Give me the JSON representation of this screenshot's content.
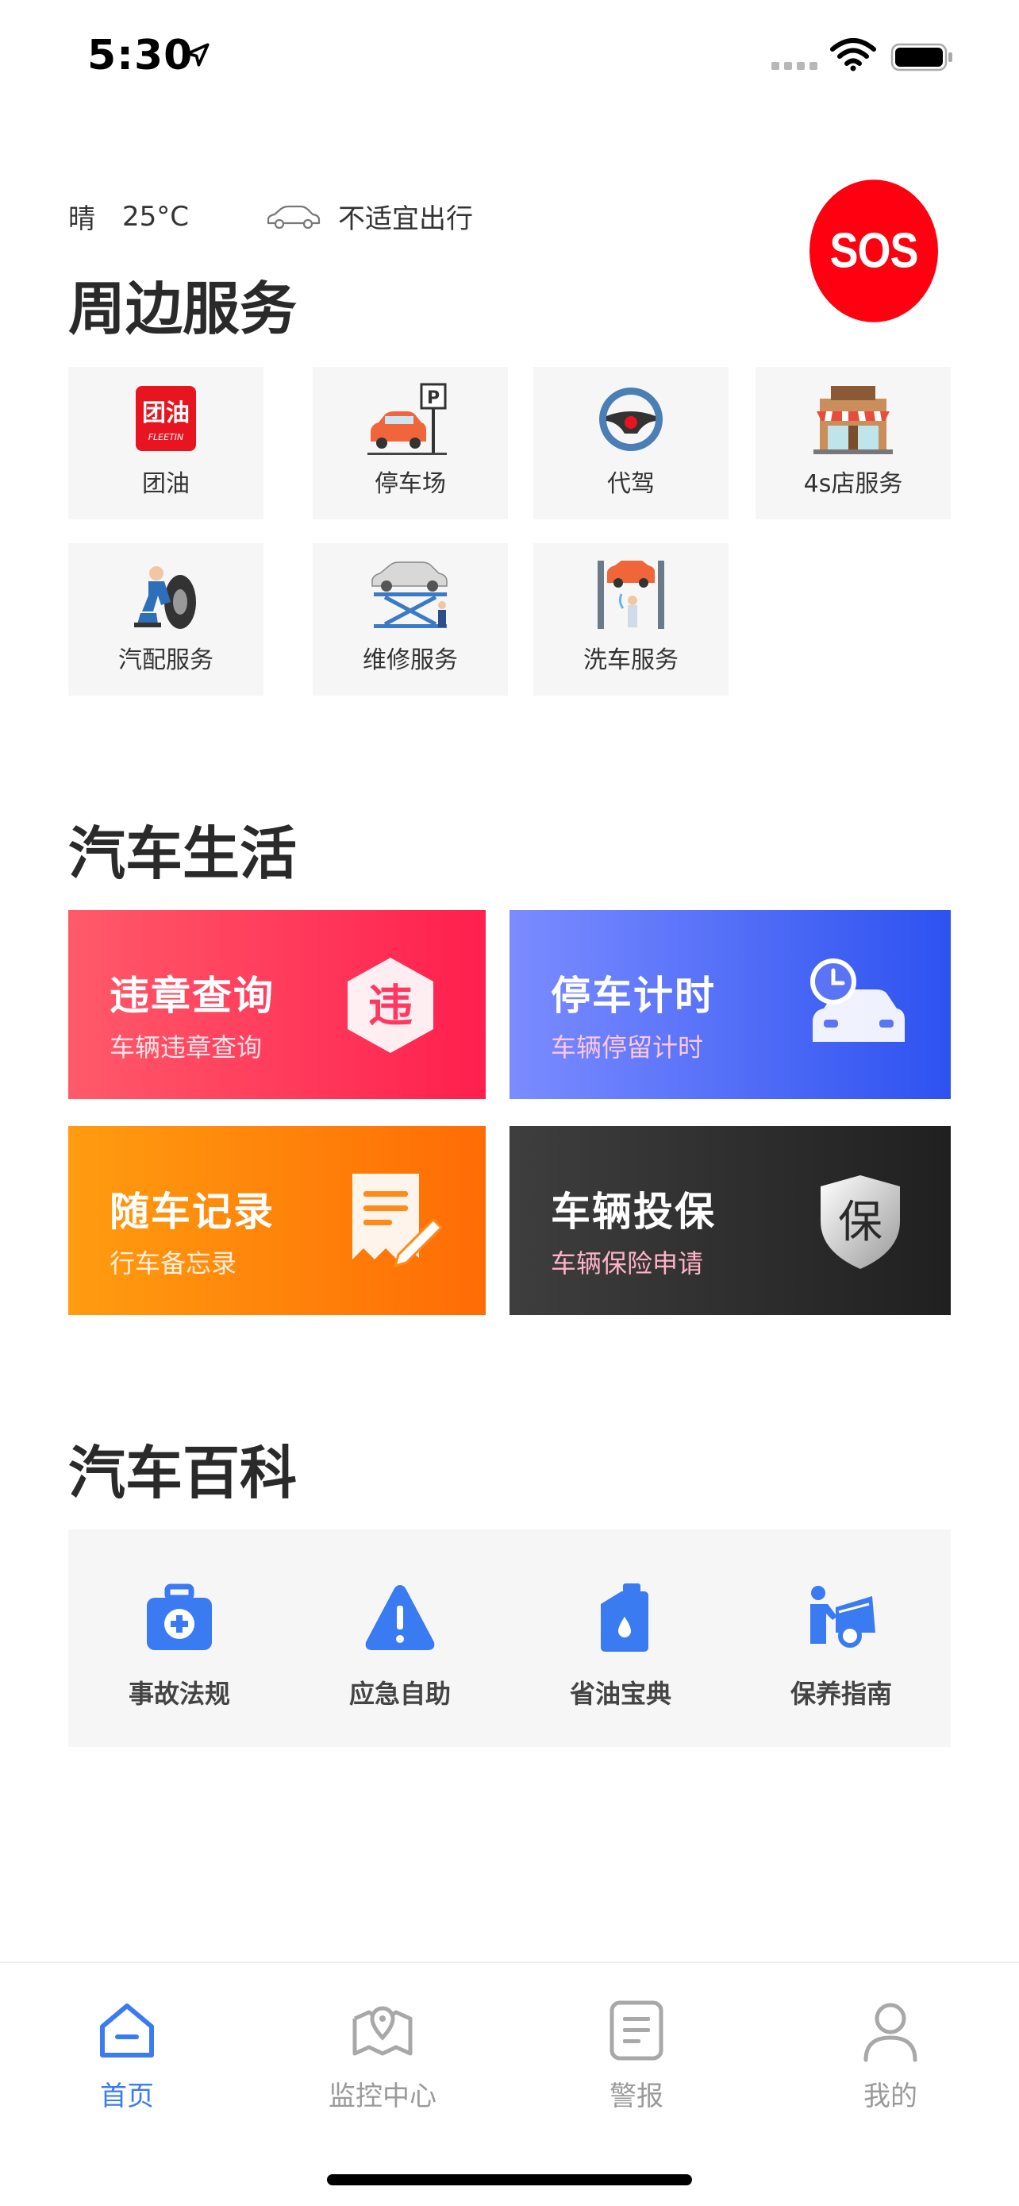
{
  "status_bar": {
    "time": "5:30"
  },
  "weather": {
    "condition": "晴",
    "temperature": "25°C",
    "travel_advice": "不适宜出行"
  },
  "sos": {
    "label": "SOS"
  },
  "sections": {
    "nearby": "周边服务",
    "car_life": "汽车生活",
    "encyclopedia": "汽车百科"
  },
  "services": [
    {
      "label": "团油",
      "icon": "fuel-logo-icon",
      "logo_text": "团油",
      "logo_sub": "FLEETIN"
    },
    {
      "label": "停车场",
      "icon": "parking-icon"
    },
    {
      "label": "代驾",
      "icon": "steering-wheel-icon"
    },
    {
      "label": "4s店服务",
      "icon": "dealership-icon"
    },
    {
      "label": "汽配服务",
      "icon": "tire-mechanic-icon"
    },
    {
      "label": "维修服务",
      "icon": "car-lift-icon"
    },
    {
      "label": "洗车服务",
      "icon": "car-wash-icon"
    }
  ],
  "car_life": [
    {
      "title": "违章查询",
      "subtitle": "车辆违章查询",
      "icon": "violation-icon",
      "glyph": "违"
    },
    {
      "title": "停车计时",
      "subtitle": "车辆停留计时",
      "icon": "parking-timer-icon"
    },
    {
      "title": "随车记录",
      "subtitle": "行车备忘录",
      "icon": "note-icon"
    },
    {
      "title": "车辆投保",
      "subtitle": "车辆保险申请",
      "icon": "insurance-shield-icon",
      "glyph": "保"
    }
  ],
  "encyclopedia": [
    {
      "label": "事故法规",
      "icon": "first-aid-kit-icon"
    },
    {
      "label": "应急自助",
      "icon": "warning-triangle-icon"
    },
    {
      "label": "省油宝典",
      "icon": "oil-can-icon"
    },
    {
      "label": "保养指南",
      "icon": "car-maintenance-icon"
    }
  ],
  "tabs": [
    {
      "label": "首页",
      "icon": "home-icon",
      "active": true
    },
    {
      "label": "监控中心",
      "icon": "map-pin-icon",
      "active": false
    },
    {
      "label": "警报",
      "icon": "document-icon",
      "active": false
    },
    {
      "label": "我的",
      "icon": "user-icon",
      "active": false
    }
  ],
  "colors": {
    "accent": "#3b7bf2",
    "sos": "#ff0010",
    "icon_blue": "#3b7bf2"
  }
}
